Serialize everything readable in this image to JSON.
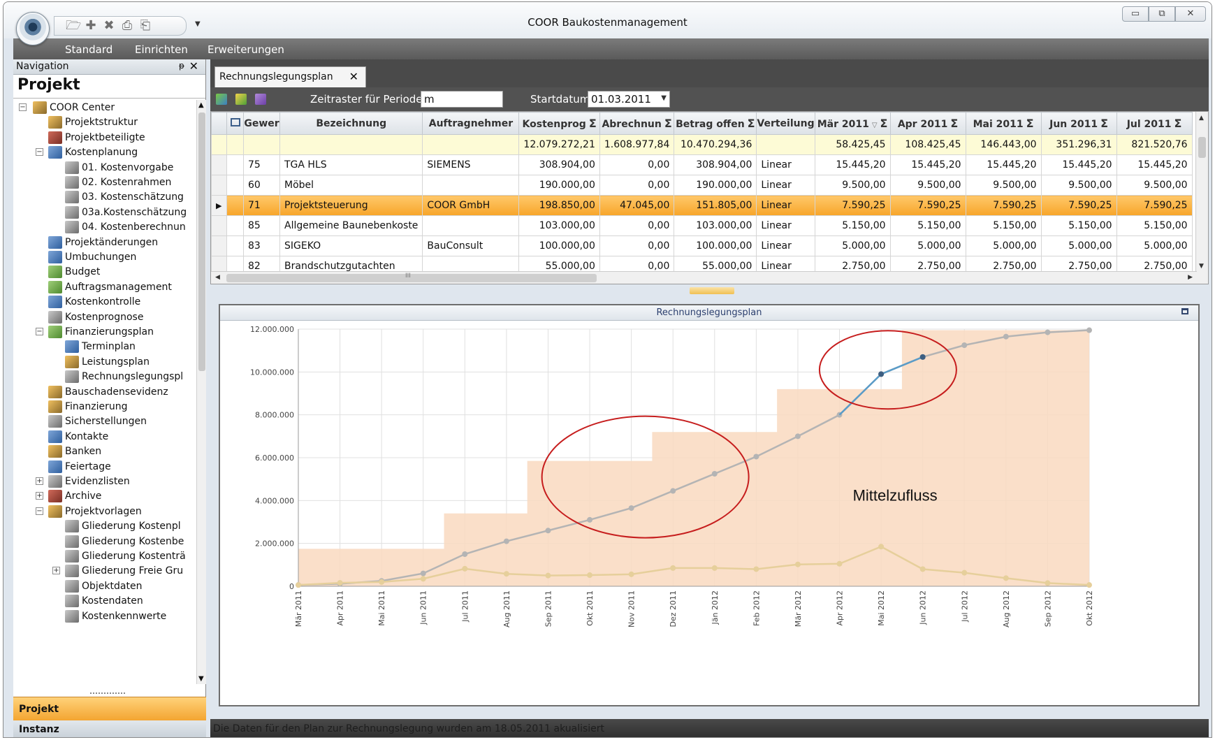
{
  "window": {
    "title": "COOR Baukostenmanagement",
    "minimize_glyph": "▭",
    "restore_glyph": "⧉",
    "close_glyph": "✕"
  },
  "quick_access": {
    "icons": [
      "open-folder-icon",
      "add-icon",
      "delete-icon",
      "print-icon",
      "print-preview-icon"
    ]
  },
  "menu": {
    "items": [
      "Standard",
      "Einrichten",
      "Erweiterungen"
    ]
  },
  "navigation": {
    "header": "Navigation",
    "pin_glyph": "ᵽ",
    "close_glyph": "✕",
    "section_title": "Projekt",
    "tree": [
      {
        "label": "COOR Center",
        "level": 0,
        "expander": "−",
        "icon": "icon-a"
      },
      {
        "label": "Projektstruktur",
        "level": 1,
        "expander": "",
        "icon": "icon-a"
      },
      {
        "label": "Projektbeteiligte",
        "level": 1,
        "expander": "",
        "icon": "icon-c"
      },
      {
        "label": "Kostenplanung",
        "level": 1,
        "expander": "−",
        "icon": "icon-b"
      },
      {
        "label": "01. Kostenvorgabe",
        "level": 2,
        "expander": "",
        "icon": "icon-e"
      },
      {
        "label": "02. Kostenrahmen",
        "level": 2,
        "expander": "",
        "icon": "icon-e"
      },
      {
        "label": "03. Kostenschätzung",
        "level": 2,
        "expander": "",
        "icon": "icon-e"
      },
      {
        "label": "03a.Kostenschätzung",
        "level": 2,
        "expander": "",
        "icon": "icon-e"
      },
      {
        "label": "04. Kostenberechnun",
        "level": 2,
        "expander": "",
        "icon": "icon-e"
      },
      {
        "label": "Projektänderungen",
        "level": 1,
        "expander": "",
        "icon": "icon-b"
      },
      {
        "label": "Umbuchungen",
        "level": 1,
        "expander": "",
        "icon": "icon-b"
      },
      {
        "label": "Budget",
        "level": 1,
        "expander": "",
        "icon": "icon-d"
      },
      {
        "label": "Auftragsmanagement",
        "level": 1,
        "expander": "",
        "icon": "icon-d"
      },
      {
        "label": "Kostenkontrolle",
        "level": 1,
        "expander": "",
        "icon": "icon-b"
      },
      {
        "label": "Kostenprognose",
        "level": 1,
        "expander": "",
        "icon": "icon-e"
      },
      {
        "label": "Finanzierungsplan",
        "level": 1,
        "expander": "−",
        "icon": "icon-d"
      },
      {
        "label": "Terminplan",
        "level": 2,
        "expander": "",
        "icon": "icon-b"
      },
      {
        "label": "Leistungsplan",
        "level": 2,
        "expander": "",
        "icon": "icon-a"
      },
      {
        "label": "Rechnungslegungspl",
        "level": 2,
        "expander": "",
        "icon": "icon-e"
      },
      {
        "label": "Bauschadensevidenz",
        "level": 1,
        "expander": "",
        "icon": "icon-a"
      },
      {
        "label": "Finanzierung",
        "level": 1,
        "expander": "",
        "icon": "icon-a"
      },
      {
        "label": "Sicherstellungen",
        "level": 1,
        "expander": "",
        "icon": "icon-e"
      },
      {
        "label": "Kontakte",
        "level": 1,
        "expander": "",
        "icon": "icon-b"
      },
      {
        "label": "Banken",
        "level": 1,
        "expander": "",
        "icon": "icon-a"
      },
      {
        "label": "Feiertage",
        "level": 1,
        "expander": "",
        "icon": "icon-b"
      },
      {
        "label": "Evidenzlisten",
        "level": 1,
        "expander": "+",
        "icon": "icon-e"
      },
      {
        "label": "Archive",
        "level": 1,
        "expander": "+",
        "icon": "icon-c"
      },
      {
        "label": "Projektvorlagen",
        "level": 1,
        "expander": "−",
        "icon": "icon-a"
      },
      {
        "label": "Gliederung Kostenpl",
        "level": 2,
        "expander": "",
        "icon": "icon-e"
      },
      {
        "label": "Gliederung Kostenbe",
        "level": 2,
        "expander": "",
        "icon": "icon-e"
      },
      {
        "label": "Gliederung Kostenträ",
        "level": 2,
        "expander": "",
        "icon": "icon-e"
      },
      {
        "label": "Gliederung Freie Gru",
        "level": 2,
        "expander": "+",
        "icon": "icon-e"
      },
      {
        "label": "Objektdaten",
        "level": 2,
        "expander": "",
        "icon": "icon-e"
      },
      {
        "label": "Kostendaten",
        "level": 2,
        "expander": "",
        "icon": "icon-e"
      },
      {
        "label": "Kostenkennwerte",
        "level": 2,
        "expander": "",
        "icon": "icon-e"
      }
    ],
    "bottom_tabs": {
      "active": "Projekt",
      "inactive": "Instanz"
    }
  },
  "document_tab": {
    "label": "Rechnungslegungsplan",
    "close_glyph": "✕"
  },
  "toolbar": {
    "zeitraster_label": "Zeitraster für Perioden",
    "zeitraster_value": "m",
    "startdatum_label": "Startdatum",
    "startdatum_value": "01.03.2011",
    "dropdown_glyph": "▼"
  },
  "grid": {
    "columns": [
      "Gewer",
      "Bezeichnung",
      "Auftragnehmer",
      "Kostenprog",
      "Abrechnun",
      "Betrag offen",
      "Verteilung",
      "Mär 2011",
      "Apr 2011",
      "Mai 2011",
      "Jun 2011",
      "Jul 2011"
    ],
    "sigma": "Σ",
    "sort_glyph": "▽",
    "sums": [
      "",
      "",
      "",
      "12.079.272,21",
      "1.608.977,84",
      "10.470.294,36",
      "",
      "58.425,45",
      "108.425,45",
      "146.443,00",
      "351.296,31",
      "821.520,76"
    ],
    "rows": [
      [
        "75",
        "TGA HLS",
        "SIEMENS",
        "308.904,00",
        "0,00",
        "308.904,00",
        "Linear",
        "15.445,20",
        "15.445,20",
        "15.445,20",
        "15.445,20",
        "15.445,20"
      ],
      [
        "60",
        "Möbel",
        "",
        "190.000,00",
        "0,00",
        "190.000,00",
        "Linear",
        "9.500,00",
        "9.500,00",
        "9.500,00",
        "9.500,00",
        "9.500,00"
      ],
      [
        "71",
        "Projektsteuerung",
        "COOR GmbH",
        "198.850,00",
        "47.045,00",
        "151.805,00",
        "Linear",
        "7.590,25",
        "7.590,25",
        "7.590,25",
        "7.590,25",
        "7.590,25"
      ],
      [
        "85",
        "Allgemeine Baunebenkoste",
        "",
        "103.000,00",
        "0,00",
        "103.000,00",
        "Linear",
        "5.150,00",
        "5.150,00",
        "5.150,00",
        "5.150,00",
        "5.150,00"
      ],
      [
        "83",
        "SIGEKO",
        "BauConsult",
        "100.000,00",
        "0,00",
        "100.000,00",
        "Linear",
        "5.000,00",
        "5.000,00",
        "5.000,00",
        "5.000,00",
        "5.000,00"
      ],
      [
        "82",
        "Brandschutzgutachten",
        "",
        "55.000,00",
        "0,00",
        "55.000,00",
        "Linear",
        "2.750,00",
        "2.750,00",
        "2.750,00",
        "2.750,00",
        "2.750,00"
      ]
    ],
    "selected_row": 2,
    "current_row_glyph": "▶",
    "hscroll_grip": "III"
  },
  "chart_data": {
    "type": "line",
    "title": "Rechnungslegungsplan",
    "annotation": "Mittelzufluss",
    "categories": [
      "Mär 2011",
      "Apr 2011",
      "Mai 2011",
      "Jun 2011",
      "Jul 2011",
      "Aug 2011",
      "Sep 2011",
      "Okt 2011",
      "Nov 2011",
      "Dez 2011",
      "Jän 2012",
      "Feb 2012",
      "Mär 2012",
      "Apr 2012",
      "Mai 2012",
      "Jun 2012",
      "Jul 2012",
      "Aug 2012",
      "Sep 2012",
      "Okt 2012"
    ],
    "y_ticks": [
      "0",
      "2.000.000",
      "4.000.000",
      "6.000.000",
      "8.000.000",
      "10.000.000",
      "12.000.000"
    ],
    "ylim": [
      0,
      12000000
    ],
    "grid": true,
    "series": [
      {
        "kind": "line",
        "values": [
          60000,
          120000,
          250000,
          600000,
          1500000,
          2100000,
          2600000,
          3100000,
          3650000,
          4450000,
          5250000,
          6050000,
          7000000,
          8000000,
          9900000,
          10700000,
          11250000,
          11650000,
          11850000,
          11950000
        ]
      },
      {
        "kind": "line",
        "values": [
          60000,
          160000,
          200000,
          350000,
          820000,
          580000,
          500000,
          520000,
          560000,
          850000,
          850000,
          800000,
          1020000,
          1050000,
          1850000,
          800000,
          630000,
          380000,
          150000,
          60000
        ]
      },
      {
        "kind": "step-area",
        "values": [
          1750000,
          1750000,
          1750000,
          1750000,
          3400000,
          3400000,
          5850000,
          5850000,
          5850000,
          7200000,
          7200000,
          7200000,
          9200000,
          9200000,
          9200000,
          11950000,
          11950000,
          11950000,
          11950000,
          11950000
        ]
      }
    ],
    "highlight_range": [
      14,
      15
    ],
    "colors": {
      "cumulative": "#b4b4b4",
      "monthly": "#e6cf9b",
      "area": "#f9d9bf",
      "highlight": "#5a9cc8",
      "ellipse": "#c61d1d",
      "grid": "#e0e0e0"
    }
  },
  "status_bar": {
    "text": "Die Daten für den Plan zur Rechnungslegung wurden am 18.05.2011 akualisiert"
  }
}
